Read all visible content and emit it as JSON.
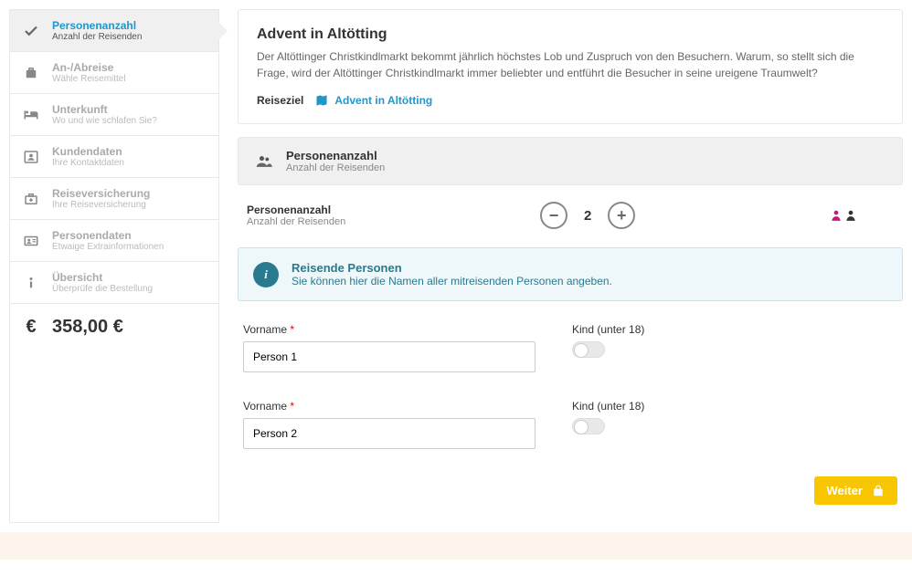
{
  "sidebar": {
    "steps": [
      {
        "title": "Personenanzahl",
        "sub": "Anzahl der Reisenden"
      },
      {
        "title": "An-/Abreise",
        "sub": "Wähle Reisemittel"
      },
      {
        "title": "Unterkunft",
        "sub": "Wo und wie schlafen Sie?"
      },
      {
        "title": "Kundendaten",
        "sub": "Ihre Kontaktdaten"
      },
      {
        "title": "Reiseversicherung",
        "sub": "Ihre Reiseversicherung"
      },
      {
        "title": "Personendaten",
        "sub": "Etwaige Extrainformationen"
      },
      {
        "title": "Übersicht",
        "sub": "Überprüfe die Bestellung"
      }
    ],
    "price": "358,00 €"
  },
  "header": {
    "title": "Advent in Altötting",
    "desc": "Der Altöttinger Christkindlmarkt bekommt jährlich höchstes Lob und Zuspruch von den Besuchern. Warum, so stellt sich die Frage, wird der Altöttinger Christkindlmarkt immer beliebter und entführt die Besucher in seine ureigene Traumwelt?",
    "dest_label": "Reiseziel",
    "dest_link": "Advent in Altötting"
  },
  "section": {
    "title": "Personenanzahl",
    "sub": "Anzahl der Reisenden"
  },
  "counter": {
    "title": "Personenanzahl",
    "sub": "Anzahl der Reisenden",
    "value": "2"
  },
  "info": {
    "title": "Reisende Personen",
    "sub": "Sie können hier die Namen aller mitreisenden Personen angeben."
  },
  "form": {
    "vorname_label": "Vorname",
    "kind_label": "Kind (unter 18)",
    "persons": [
      {
        "name": "Person 1"
      },
      {
        "name": "Person 2"
      }
    ]
  },
  "actions": {
    "next": "Weiter"
  }
}
